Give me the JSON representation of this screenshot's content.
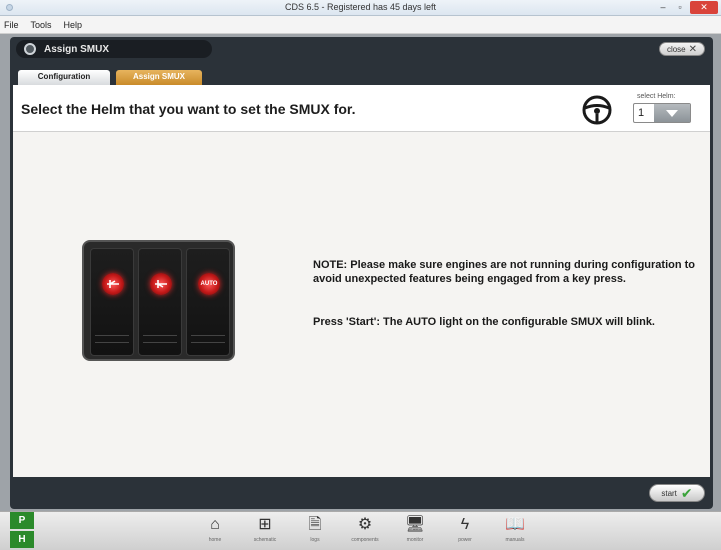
{
  "window": {
    "title": "CDS 6.5 - Registered has 45 days left",
    "minimize": "–",
    "maximize": "▫",
    "close": "✕"
  },
  "menu": [
    "File",
    "Tools",
    "Help"
  ],
  "module": {
    "title": "Assign SMUX",
    "close_label": "close",
    "close_icon": "✕"
  },
  "tabs": [
    {
      "label": "Configuration",
      "active": false
    },
    {
      "label": "Assign SMUX",
      "active": true
    }
  ],
  "content": {
    "heading": "Select the Helm that you want to set the SMUX for.",
    "helm": {
      "label": "select Helm:",
      "value": "1"
    },
    "smux_keys": [
      {
        "icon": "trim-icon"
      },
      {
        "icon": "trim-icon"
      },
      {
        "icon": "auto-icon",
        "label": "AUTO"
      }
    ],
    "note": "NOTE: Please make sure engines are not running during configuration to avoid unexpected features being engaged from a key press.",
    "instruction": "Press 'Start': The AUTO light on the configurable SMUX will blink."
  },
  "footer": {
    "start_label": "start",
    "start_icon": "✔"
  },
  "taskbar": {
    "p_label": "P",
    "h_label": "H",
    "items": [
      {
        "icon": "home-icon",
        "glyph": "⌂",
        "label": "home"
      },
      {
        "icon": "diagram-icon",
        "glyph": "⊞",
        "label": "schematic"
      },
      {
        "icon": "document-icon",
        "glyph": "🗎",
        "label": "logs"
      },
      {
        "icon": "engine-icon",
        "glyph": "⚙",
        "label": "components"
      },
      {
        "icon": "monitor-icon",
        "glyph": "🖥",
        "label": "monitor"
      },
      {
        "icon": "power-icon",
        "glyph": "ϟ",
        "label": "power"
      },
      {
        "icon": "book-icon",
        "glyph": "📖",
        "label": "manuals"
      }
    ]
  }
}
